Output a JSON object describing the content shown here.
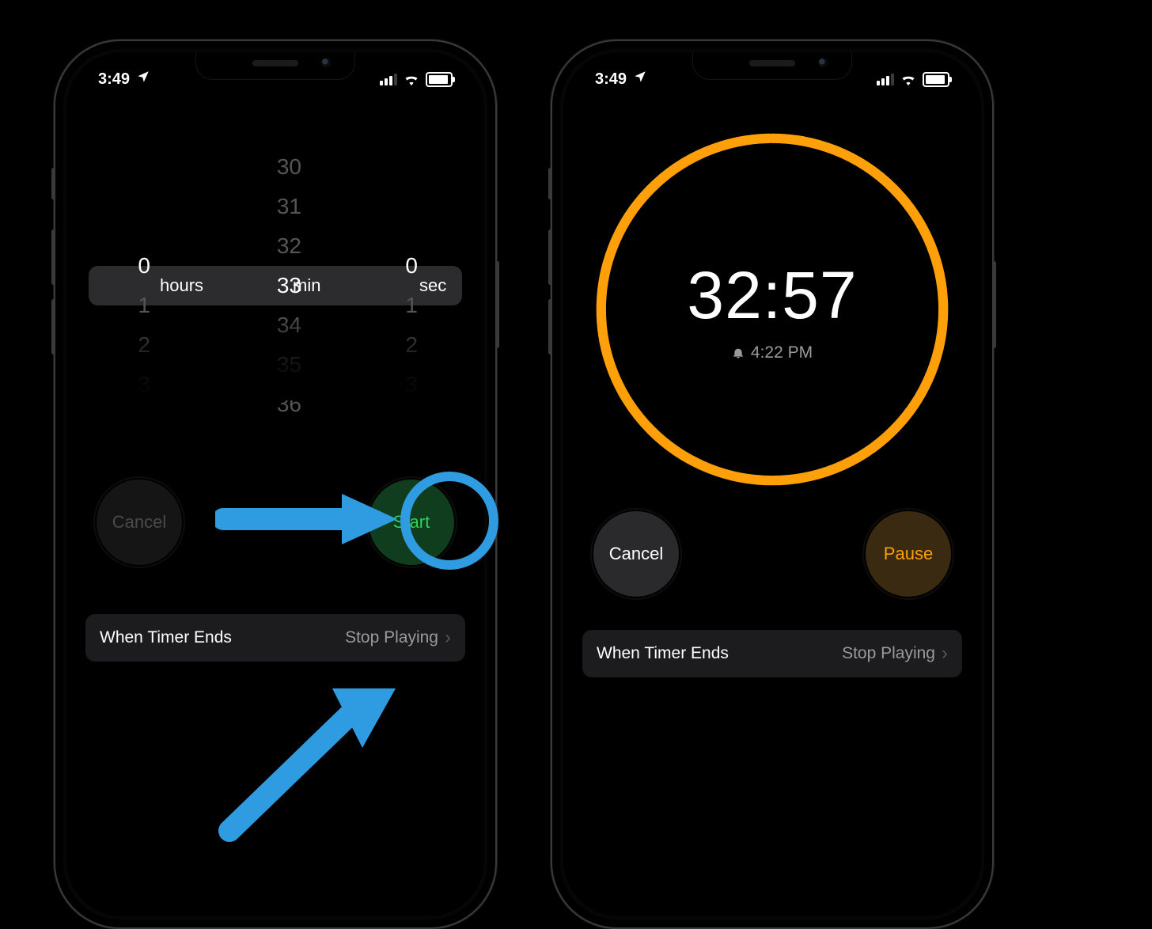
{
  "status": {
    "time": "3:49",
    "location_icon": "location-arrow",
    "signal_bars": 3,
    "wifi": true,
    "battery_pct": 90
  },
  "left_phone": {
    "picker": {
      "hours": {
        "visible": [
          "",
          "",
          "",
          "0",
          "1",
          "2",
          "3"
        ],
        "selected": "0",
        "unit": "hours"
      },
      "minutes": {
        "visible": [
          "30",
          "31",
          "32",
          "33",
          "34",
          "35",
          "36"
        ],
        "selected": "33",
        "unit": "min"
      },
      "seconds": {
        "visible": [
          "",
          "",
          "",
          "0",
          "1",
          "2",
          "3"
        ],
        "selected": "0",
        "unit": "sec"
      }
    },
    "buttons": {
      "cancel": "Cancel",
      "start": "Start"
    },
    "setting": {
      "label": "When Timer Ends",
      "value": "Stop Playing"
    }
  },
  "right_phone": {
    "countdown": {
      "remaining": "32:57",
      "ends_at": "4:22 PM",
      "ring_color": "#ff9f0a"
    },
    "buttons": {
      "cancel": "Cancel",
      "pause": "Pause"
    },
    "setting": {
      "label": "When Timer Ends",
      "value": "Stop Playing"
    }
  },
  "annotation": {
    "highlight": "start-button"
  }
}
